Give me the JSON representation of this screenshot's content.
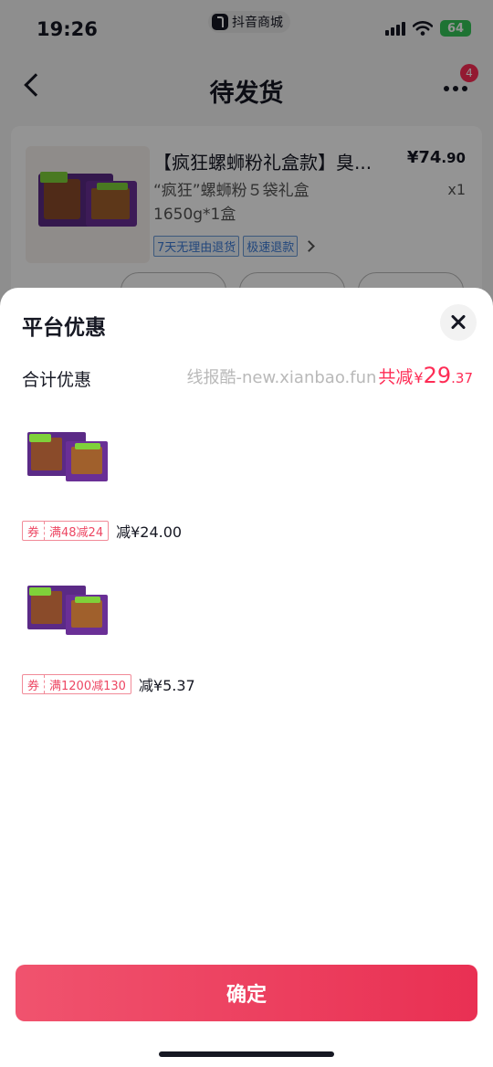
{
  "status_bar": {
    "time": "19:26",
    "app_name": "抖音商城",
    "battery": "64",
    "icons": [
      "signal-icon",
      "wifi-icon",
      "battery-icon"
    ]
  },
  "nav": {
    "title": "待发货",
    "back_icon": "chevron-left-icon",
    "more_icon": "more-icon",
    "badge_count": "4"
  },
  "order": {
    "product_name": "【疯狂螺蛳粉礼盒款】臭...",
    "price_symbol": "¥",
    "price_int": "74",
    "price_dec": ".90",
    "spec": "“疯狂”螺蛳粉５袋礼盒1650g*1盒",
    "quantity": "x1",
    "tags": [
      "7天无理由退货",
      "极速退款"
    ]
  },
  "sheet": {
    "title": "平台优惠",
    "total_label": "合计优惠",
    "watermark": "线报酷-new.xianbao.fun",
    "total_prefix": "共减",
    "total_yen": "¥",
    "total_int": "29",
    "total_dec": ".37",
    "coupons": [
      {
        "tag": "券",
        "rule": "满48减24",
        "amount": "减¥24.00"
      },
      {
        "tag": "券",
        "rule": "满1200减130",
        "amount": "减¥5.37"
      }
    ],
    "confirm_label": "确定"
  },
  "colors": {
    "accent": "#fe2c55",
    "confirm_start": "#f0536e",
    "confirm_end": "#e93053"
  }
}
